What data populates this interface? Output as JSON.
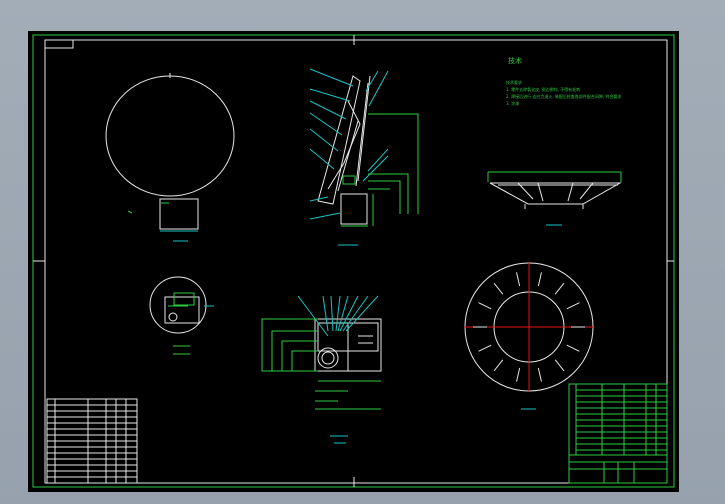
{
  "drawing": {
    "tech_title": "技术",
    "tech_lines": [
      "技术要求",
      "1. 零件去除氧化皮, 锐边倒钝, 不得有毛刺",
      "2. 焊接后进行 去应力退火, 装配后检查各部件配合间隙, 符合要求",
      "3. 涂漆"
    ],
    "view_labels": {
      "section_a": "A-A",
      "detail_i": "I 放大",
      "detail_scale": "2:1",
      "main_view": "主视图",
      "partial_view": "局部视图 A",
      "partial_scale": "1:1"
    },
    "colors": {
      "frame": "#2ecc40",
      "outline": "#e8e8e8",
      "dimension": "#19c3c3",
      "center": "#e51515"
    }
  }
}
